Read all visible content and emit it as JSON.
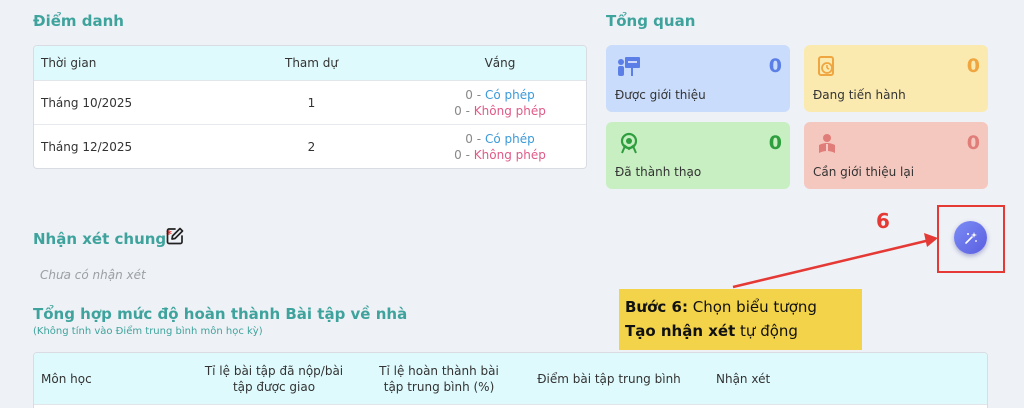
{
  "attendance": {
    "title": "Điểm danh",
    "headers": {
      "time": "Thời gian",
      "attended": "Tham dự",
      "absent": "Vắng"
    },
    "rows": [
      {
        "time": "Tháng 10/2025",
        "attended": "1",
        "excused_count": "0",
        "excused_label": "Có phép",
        "unexcused_count": "0",
        "unexcused_label": "Không phép"
      },
      {
        "time": "Tháng 12/2025",
        "attended": "2",
        "excused_count": "0",
        "excused_label": "Có phép",
        "unexcused_count": "0",
        "unexcused_label": "Không phép"
      }
    ],
    "dash": "-"
  },
  "overview": {
    "title": "Tổng quan",
    "cards": [
      {
        "label": "Được giới thiệu",
        "value": "0",
        "bg": "#c9dcfb",
        "accent": "#5b7fe6",
        "icon": "presentation-icon"
      },
      {
        "label": "Đang tiến hành",
        "value": "0",
        "bg": "#fbeab0",
        "accent": "#f0a640",
        "icon": "document-clock-icon"
      },
      {
        "label": "Đã thành thạo",
        "value": "0",
        "bg": "#c7efc1",
        "accent": "#2e9e3f",
        "icon": "award-icon"
      },
      {
        "label": "Cần giới thiệu lại",
        "value": "0",
        "bg": "#f5c8bf",
        "accent": "#e07d78",
        "icon": "student-book-icon"
      }
    ]
  },
  "general_comment": {
    "title": "Nhận xét chung",
    "required_mark": "*",
    "placeholder": "Chưa có nhận xét"
  },
  "homework": {
    "title": "Tổng hợp mức độ hoàn thành Bài tập về nhà",
    "subtitle": "(Không tính vào Điểm trung bình môn học kỳ)",
    "headers": {
      "subject": "Môn học",
      "submitted_ratio": "Tỉ lệ bài tập đã nộp/bài tập được giao",
      "completion_ratio": "Tỉ lệ hoàn thành bài tập trung bình (%)",
      "avg_score": "Điểm bài tập trung bình",
      "comment": "Nhận xét"
    }
  },
  "annotation": {
    "step_number": "6",
    "line1_bold": "Bước 6:",
    "line1_rest": " Chọn biểu tượng",
    "line2_bold": "Tạo nhận xét",
    "line2_rest": " tự động"
  },
  "colors": {
    "accent": "#3fa39d",
    "annotation_red": "#e53935",
    "callout_yellow": "#f3d34a"
  }
}
